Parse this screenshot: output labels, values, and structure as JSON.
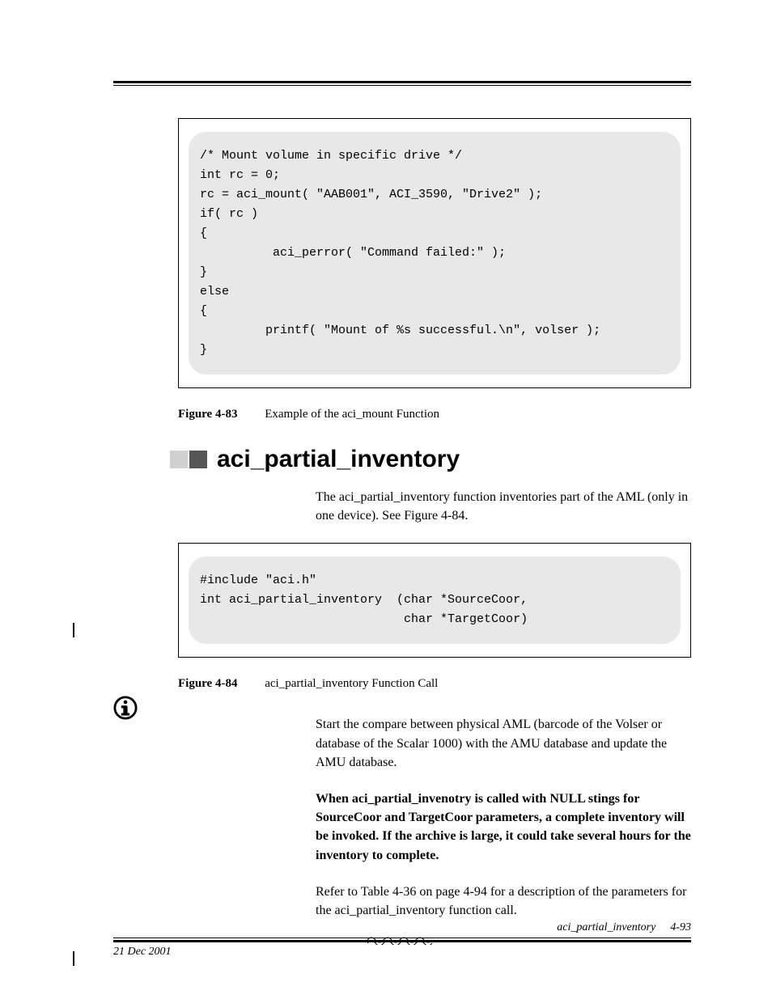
{
  "code_block_1": "/* Mount volume in specific drive */\nint rc = 0;\nrc = aci_mount( \"AAB001\", ACI_3590, \"Drive2\" );\nif( rc )\n{\n          aci_perror( \"Command failed:\" );\n}\nelse\n{\n         printf( \"Mount of %s successful.\\n\", volser );\n}",
  "figure83": {
    "label": "Figure 4-83",
    "caption": "Example of the aci_mount Function"
  },
  "section_title": "aci_partial_inventory",
  "intro_para": "The aci_partial_inventory function inventories part of the AML (only in one device). See Figure 4-84.",
  "code_block_2": "#include \"aci.h\"\nint aci_partial_inventory  (char *SourceCoor,\n                            char *TargetCoor)",
  "figure84": {
    "label": "Figure 4-84",
    "caption": "aci_partial_inventory Function Call"
  },
  "para2": "Start the compare between physical AML (barcode of the Volser or database of the Scalar 1000) with the AMU database and update the AMU database.",
  "para3": "When aci_partial_invenotry is called with NULL stings for SourceCoor and TargetCoor parameters, a complete inventory will be invoked. If the archive is large, it could take several hours for the inventory to complete.",
  "para4": "Refer to Table 4-36 on page 4-94 for a description of the parameters for the aci_partial_inventory function call.",
  "footer": {
    "title": "aci_partial_inventory",
    "page": "4-93",
    "date": "21 Dec 2001"
  }
}
